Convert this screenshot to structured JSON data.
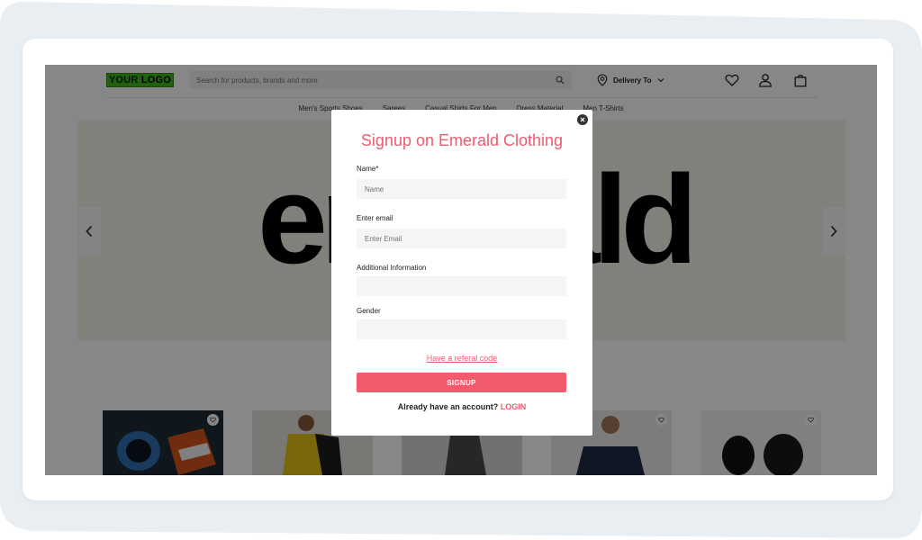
{
  "header": {
    "logo_part1": "YOUR ",
    "logo_part2": "LOGO",
    "search_placeholder": "Search for products, brands and more",
    "delivery_label": "Delivery To"
  },
  "nav": {
    "items": [
      "Men's Sports Shoes",
      "Sarees",
      "Casual Shirts For Men",
      "Dress Material",
      "Men T-Shirts"
    ]
  },
  "banner": {
    "word": "emerald"
  },
  "modal": {
    "title": "Signup on Emerald Clothing",
    "name_label": "Name*",
    "name_placeholder": "Name",
    "email_label": "Enter email",
    "email_placeholder": "Enter Email",
    "additional_label": "Additional Information",
    "gender_label": "Gender",
    "referral_link": "Have a referal code",
    "signup_button": "SIGNUP",
    "already_text": "Already have an account?",
    "login_link": "LOGIN"
  },
  "colors": {
    "accent": "#ef5a6f",
    "logo_green": "#3cb521",
    "overlay": "rgba(0,0,0,0.47)"
  },
  "icons": [
    "search-icon",
    "location-pin-icon",
    "chevron-down-icon",
    "heart-icon",
    "user-icon",
    "bag-icon",
    "chevron-left-icon",
    "chevron-right-icon",
    "close-icon"
  ]
}
